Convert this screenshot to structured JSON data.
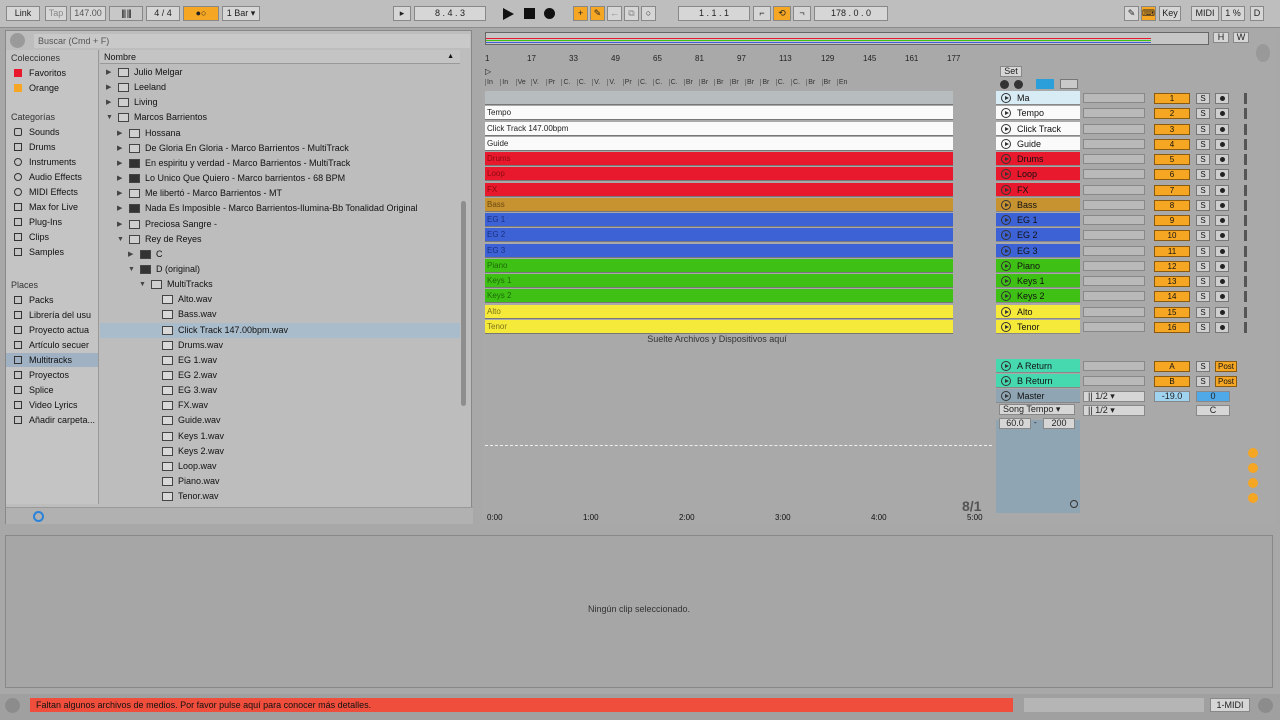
{
  "toolbar": {
    "link": "Link",
    "tap": "Tap",
    "tempo": "147.00",
    "signature": "4 / 4",
    "metro": "●○",
    "quantize": "1 Bar",
    "position": "8 .  4 .  3",
    "loop_start": "1 .  1 .  1",
    "loop_length": "178 .  0 .  0",
    "key": "Key",
    "midi": "MIDI",
    "cpu": "1 %",
    "disk": "D"
  },
  "browser": {
    "search_placeholder": "Buscar (Cmd + F)",
    "column_header": "Nombre",
    "collections_title": "Colecciones",
    "collections": [
      {
        "label": "Favoritos",
        "color": "#e8192c"
      },
      {
        "label": "Orange",
        "color": "#f5a623"
      }
    ],
    "categories_title": "Categorías",
    "categories": [
      "Sounds",
      "Drums",
      "Instruments",
      "Audio Effects",
      "MIDI Effects",
      "Max for Live",
      "Plug-Ins",
      "Clips",
      "Samples"
    ],
    "places_title": "Places",
    "places": [
      "Packs",
      "Librería del usu",
      "Proyecto actua",
      "Artículo secuer",
      "Multitracks",
      "Proyectos",
      "Splice",
      "Video Lyrics",
      "Añadir carpeta..."
    ],
    "selected_place": "Multitracks",
    "files": [
      {
        "label": "Julio Melgar",
        "indent": 0,
        "tri": "▶",
        "icon": "folder"
      },
      {
        "label": "Leeland",
        "indent": 0,
        "tri": "▶",
        "icon": "folder"
      },
      {
        "label": "Living",
        "indent": 0,
        "tri": "▶",
        "icon": "folder"
      },
      {
        "label": "Marcos Barrientos",
        "indent": 0,
        "tri": "▼",
        "icon": "folder"
      },
      {
        "label": "Hossana",
        "indent": 1,
        "tri": "▶",
        "icon": "folder"
      },
      {
        "label": "De Gloria En Gloria - Marco Barrientos - MultiTrack",
        "indent": 1,
        "tri": "▶",
        "icon": "folder"
      },
      {
        "label": "En espiritu y verdad - Marco Barrientos - MultiTrack",
        "indent": 1,
        "tri": "▶",
        "icon": "dark"
      },
      {
        "label": "Lo Unico Que Quiero - Marco barrientos - 68 BPM",
        "indent": 1,
        "tri": "▶",
        "icon": "dark"
      },
      {
        "label": "Me libertó - Marco Barrientos - MT",
        "indent": 1,
        "tri": "▶",
        "icon": "folder"
      },
      {
        "label": "Nada Es Imposible - Marco Barrientos-Ilumina-Bb Tonalidad Original",
        "indent": 1,
        "tri": "▶",
        "icon": "dark"
      },
      {
        "label": "Preciosa Sangre -",
        "indent": 1,
        "tri": "▶",
        "icon": "folder"
      },
      {
        "label": "Rey de Reyes",
        "indent": 1,
        "tri": "▼",
        "icon": "folder"
      },
      {
        "label": "C",
        "indent": 2,
        "tri": "▶",
        "icon": "dark"
      },
      {
        "label": "D (original)",
        "indent": 2,
        "tri": "▼",
        "icon": "dark"
      },
      {
        "label": "MultiTracks",
        "indent": 3,
        "tri": "▼",
        "icon": "folder"
      },
      {
        "label": "Alto.wav",
        "indent": 4,
        "tri": "",
        "icon": "wav"
      },
      {
        "label": "Bass.wav",
        "indent": 4,
        "tri": "",
        "icon": "wav"
      },
      {
        "label": "Click Track 147.00bpm.wav",
        "indent": 4,
        "tri": "",
        "icon": "wav",
        "selected": true
      },
      {
        "label": "Drums.wav",
        "indent": 4,
        "tri": "",
        "icon": "wav"
      },
      {
        "label": "EG 1.wav",
        "indent": 4,
        "tri": "",
        "icon": "wav"
      },
      {
        "label": "EG 2.wav",
        "indent": 4,
        "tri": "",
        "icon": "wav"
      },
      {
        "label": "EG 3.wav",
        "indent": 4,
        "tri": "",
        "icon": "wav"
      },
      {
        "label": "FX.wav",
        "indent": 4,
        "tri": "",
        "icon": "wav"
      },
      {
        "label": "Guide.wav",
        "indent": 4,
        "tri": "",
        "icon": "wav"
      },
      {
        "label": "Keys 1.wav",
        "indent": 4,
        "tri": "",
        "icon": "wav"
      },
      {
        "label": "Keys 2.wav",
        "indent": 4,
        "tri": "",
        "icon": "wav"
      },
      {
        "label": "Loop.wav",
        "indent": 4,
        "tri": "",
        "icon": "wav"
      },
      {
        "label": "Piano.wav",
        "indent": 4,
        "tri": "",
        "icon": "wav"
      },
      {
        "label": "Tenor.wav",
        "indent": 4,
        "tri": "",
        "icon": "wav"
      }
    ]
  },
  "arrangement": {
    "set_label": "Set",
    "hw": [
      "H",
      "W"
    ],
    "ruler_bars": [
      "1",
      "17",
      "33",
      "49",
      "65",
      "81",
      "97",
      "113",
      "129",
      "145",
      "161",
      "177"
    ],
    "locators": [
      "In",
      "In",
      "Ve",
      "V.",
      "Pr",
      "C.",
      "C.",
      "V.",
      "V.",
      "Pr",
      "C.",
      "C.",
      "C.",
      "Br",
      "Br",
      "Br",
      "Br",
      "Br",
      "Br",
      "C.",
      "C.",
      "Br",
      "Br",
      "En"
    ],
    "time_labels": [
      "0:00",
      "1:00",
      "2:00",
      "3:00",
      "4:00",
      "5:00"
    ],
    "drop_hint": "Suelte Archivos y Dispositivos aquí",
    "time_sig": "8/1",
    "tracks": [
      {
        "clip": "",
        "name": "Ma",
        "color": "gray",
        "hdr": "#d8ecf5",
        "num": "1"
      },
      {
        "clip": "Tempo",
        "name": "Tempo",
        "color": "white",
        "hdr": "#fafafa",
        "num": "2"
      },
      {
        "clip": "Click Track 147.00bpm",
        "name": "Click Track",
        "color": "white",
        "hdr": "#fafafa",
        "num": "3"
      },
      {
        "clip": "Guide",
        "name": "Guide",
        "color": "white",
        "hdr": "#fafafa",
        "num": "4"
      },
      {
        "clip": "Drums",
        "name": "Drums",
        "color": "red",
        "hdr": "#e8192c",
        "num": "5"
      },
      {
        "clip": "Loop",
        "name": "Loop",
        "color": "red",
        "hdr": "#e8192c",
        "num": "6"
      },
      {
        "clip": "FX",
        "name": "FX",
        "color": "red",
        "hdr": "#e8192c",
        "num": "7"
      },
      {
        "clip": "Bass",
        "name": "Bass",
        "color": "bass",
        "hdr": "#c79230",
        "num": "8"
      },
      {
        "clip": "EG 1",
        "name": "EG 1",
        "color": "blue",
        "hdr": "#3d62d6",
        "num": "9"
      },
      {
        "clip": "EG 2",
        "name": "EG 2",
        "color": "blue",
        "hdr": "#3d62d6",
        "num": "10"
      },
      {
        "clip": "EG 3",
        "name": "EG 3",
        "color": "blue",
        "hdr": "#3d62d6",
        "num": "11"
      },
      {
        "clip": "Piano",
        "name": "Piano",
        "color": "green",
        "hdr": "#3ec114",
        "num": "12"
      },
      {
        "clip": "Keys 1",
        "name": "Keys 1",
        "color": "green",
        "hdr": "#3ec114",
        "num": "13"
      },
      {
        "clip": "Keys 2",
        "name": "Keys 2",
        "color": "green",
        "hdr": "#3ec114",
        "num": "14"
      },
      {
        "clip": "Alto",
        "name": "Alto",
        "color": "yellow",
        "hdr": "#f5ea3a",
        "num": "15"
      },
      {
        "clip": "Tenor",
        "name": "Tenor",
        "color": "yellow",
        "hdr": "#f5ea3a",
        "num": "16"
      }
    ],
    "returns": [
      {
        "name": "A Return",
        "num": "A",
        "color": "#46d9b0",
        "post": "Post"
      },
      {
        "name": "B Return",
        "num": "B",
        "color": "#46d9b0",
        "post": "Post"
      }
    ],
    "master": {
      "name": "Master",
      "song_tempo": "Song Tempo",
      "tempo_min": "60.0",
      "tempo_max": "200",
      "ratio1": "1/2",
      "ratio2": "1/2",
      "volume": "-19.0",
      "pan": "0",
      "cue": "C"
    },
    "solo_label": "S"
  },
  "detail": {
    "empty_text": "Ningún clip seleccionado."
  },
  "status": {
    "message": "Faltan algunos archivos de medios. Por favor pulse aquí para conocer más detalles.",
    "midi_label": "1-MIDI"
  }
}
